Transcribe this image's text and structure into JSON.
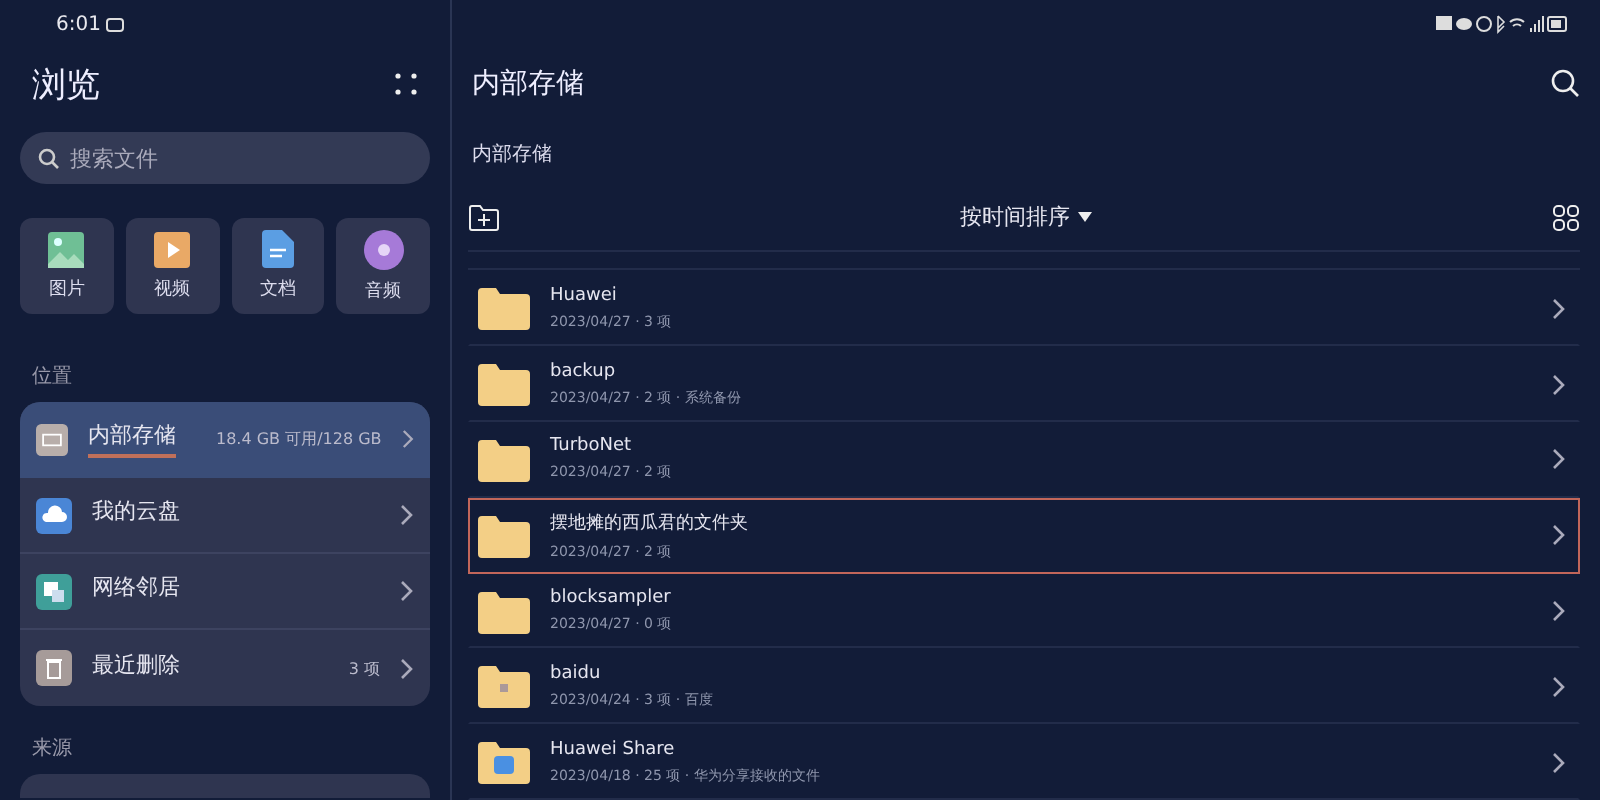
{
  "status_bar": {
    "time": "6:01"
  },
  "sidebar": {
    "title": "浏览",
    "search": {
      "placeholder": "搜索文件"
    },
    "categories": [
      {
        "label": "图片",
        "kind": "image"
      },
      {
        "label": "视频",
        "kind": "video"
      },
      {
        "label": "文档",
        "kind": "document"
      },
      {
        "label": "音频",
        "kind": "audio"
      }
    ],
    "locations_heading": "位置",
    "locations": [
      {
        "label": "内部存储",
        "detail": "18.4 GB 可用/128 GB",
        "kind": "storage",
        "selected": true
      },
      {
        "label": "我的云盘",
        "kind": "cloud",
        "selected": false
      },
      {
        "label": "网络邻居",
        "kind": "network",
        "selected": false
      },
      {
        "label": "最近删除",
        "detail": "3 项",
        "kind": "trash",
        "selected": false
      }
    ],
    "sources_heading": "来源"
  },
  "main": {
    "title": "内部存储",
    "breadcrumb": "内部存储",
    "sort_label": "按时间排序",
    "folders": [
      {
        "name": "Huawei",
        "info": "2023/04/27 · 3 项",
        "kind": "plain",
        "selected": false
      },
      {
        "name": "backup",
        "info": "2023/04/27 · 2 项 · 系统备份",
        "kind": "plain",
        "selected": false
      },
      {
        "name": "TurboNet",
        "info": "2023/04/27 · 2 项",
        "kind": "plain",
        "selected": false
      },
      {
        "name": "摆地摊的西瓜君的文件夹",
        "info": "2023/04/27 · 2 项",
        "kind": "plain",
        "selected": true
      },
      {
        "name": "blocksampler",
        "info": "2023/04/27 · 0 项",
        "kind": "plain",
        "selected": false
      },
      {
        "name": "baidu",
        "info": "2023/04/24 · 3 项 · 百度",
        "kind": "badge",
        "selected": false
      },
      {
        "name": "Huawei Share",
        "info": "2023/04/18 · 25 项 · 华为分享接收的文件",
        "kind": "share",
        "selected": false
      }
    ]
  }
}
